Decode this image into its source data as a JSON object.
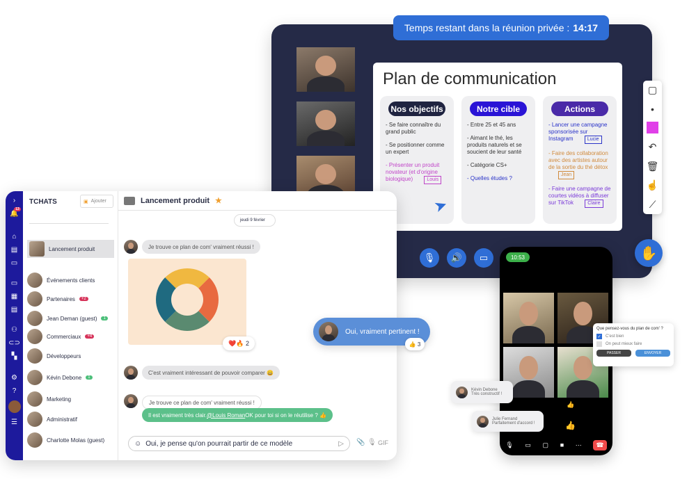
{
  "meeting": {
    "timer_label": "Temps restant dans la réunion privée :",
    "timer_value": "14:17",
    "slide": {
      "title": "Plan de communication",
      "columns": [
        {
          "header": "Nos objectifs",
          "color": "#1f2340",
          "items": [
            {
              "text": "- Se faire connaître du grand public",
              "color": "#333333"
            },
            {
              "text": "- Se positionner comme un expert",
              "color": "#333333"
            },
            {
              "text": "- Présenter un produit novateur (et d'origine biologique)",
              "color": "#c044c8",
              "tag": "Louis"
            }
          ]
        },
        {
          "header": "Notre cible",
          "color": "#2a14d6",
          "items": [
            {
              "text": "- Entre 25 et 45 ans",
              "color": "#333333"
            },
            {
              "text": "- Aimant le thé, les produits naturels et se soucient de leur santé",
              "color": "#333333"
            },
            {
              "text": "- Catégorie CS+",
              "color": "#333333"
            },
            {
              "text": "- Quelles études ?",
              "color": "#2a33c8"
            }
          ]
        },
        {
          "header": "Actions",
          "color": "#4a2aa8",
          "items": [
            {
              "text": "- Lancer une campagne sponsorisée sur Instagram",
              "color": "#2a33c8",
              "tag": "Lucie"
            },
            {
              "text": "- Faire des collaboration avec des artistes autour de la sortie du thé détox",
              "color": "#d08a3c",
              "tag": "Jean"
            },
            {
              "text": "- Faire une campagne de courtes vidéos à diffuser sur TikTok",
              "color": "#7a3ad8",
              "tag": "Claire"
            }
          ]
        }
      ]
    },
    "accent": "#2f6ed6",
    "highlight_color": "#e040e8"
  },
  "chat": {
    "title": "TCHATS",
    "add_label": "Ajouter",
    "notif_count": "13",
    "items": [
      {
        "label": "Lancement produit",
        "active": true
      },
      {
        "label": "Événements clients"
      },
      {
        "label": "Partenaires",
        "badge": "+2",
        "badge_color": "#d6335a"
      },
      {
        "label": "Jean Deman (guest)",
        "badge": "1",
        "badge_color": "#4cbf7a"
      },
      {
        "label": "Commerciaux",
        "badge": "+4",
        "badge_color": "#d6335a"
      },
      {
        "label": "Développeurs"
      },
      {
        "label": "Kévin Debone",
        "badge": "1",
        "badge_color": "#4cbf7a"
      },
      {
        "label": "Marketing"
      },
      {
        "label": "Administratif"
      },
      {
        "label": "Charlotte Molas (guest)"
      }
    ],
    "conversation": {
      "title": "Lancement produit",
      "date": "jeudi 9 février",
      "messages": [
        {
          "text": "Je trouve ce plan de com' vraiment réussi !"
        },
        {
          "text": "C'est vraiment intéressant de pouvoir comparer 😀"
        },
        {
          "text": "Je trouve ce plan de com' vraiment réussi !"
        }
      ],
      "reply_before": "Il est vraiment très clair. ",
      "reply_mention": "@Louis Roman",
      "reply_after": " OK pour toi si on le réutilise ? 👍",
      "reactions": "❤️🔥 2",
      "input_value": "Oui, je pense qu'on pourrait partir de ce modèle",
      "gif_label": "GIF"
    },
    "floating_bubble": "Oui, vraiment pertinent !",
    "floating_reaction": "👍 3"
  },
  "phone": {
    "time": "10:53",
    "poll": {
      "question": "Que pensez-vous du plan de com' ?",
      "options": [
        {
          "label": "C'est bien",
          "checked": true
        },
        {
          "label": "On peut mieux faire",
          "checked": false
        }
      ],
      "skip": "PASSER",
      "send": "ENVOYER"
    },
    "comments": [
      {
        "name": "Kévin Debone",
        "text": "Très constructif !"
      },
      {
        "name": "Julie Fernand",
        "text": "Parfaitement d'accord !"
      }
    ]
  }
}
